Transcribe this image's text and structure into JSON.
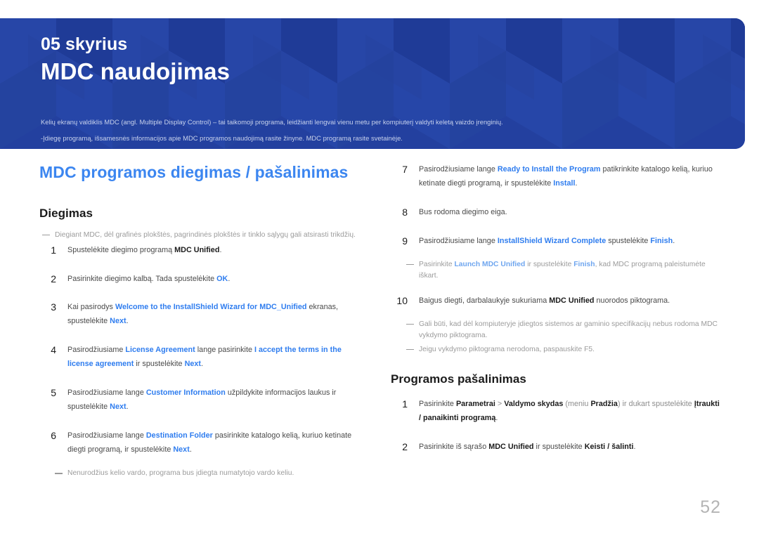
{
  "banner": {
    "chapter_label": "05 skyrius",
    "chapter_title": "MDC naudojimas",
    "description_line1": "Kelių ekranų valdiklis MDC (angl. Multiple Display Control) – tai taikomoji programa, leidžianti lengvai vienu metu per kompiuterį valdyti keletą vaizdo įrenginių.",
    "description_line2": "-Įdiegę programą, išsamesnės informacijos apie MDC programos naudojimą rasite žinyne. MDC programą rasite svetainėje.",
    "bg_color": "#23409f",
    "text_color": "#ffffff"
  },
  "section": {
    "title": "MDC programos diegimas / pašalinimas",
    "title_color": "#3c86f0"
  },
  "install": {
    "heading": "Diegimas",
    "intro_note": "Diegiant MDC, dėl grafinės plokštės, pagrindinės plokštės ir tinklo sąlygų gali atsirasti trikdžių.",
    "steps": [
      {
        "num": "1",
        "parts": [
          {
            "t": "Spustelėkite diegimo programą ",
            "s": "plain"
          },
          {
            "t": "MDC Unified",
            "s": "bold"
          },
          {
            "t": ".",
            "s": "plain"
          }
        ]
      },
      {
        "num": "2",
        "parts": [
          {
            "t": "Pasirinkite diegimo kalbą. Tada spustelėkite ",
            "s": "plain"
          },
          {
            "t": "OK",
            "s": "link"
          },
          {
            "t": ".",
            "s": "plain"
          }
        ]
      },
      {
        "num": "3",
        "parts": [
          {
            "t": "Kai pasirodys ",
            "s": "plain"
          },
          {
            "t": "Welcome to the InstallShield Wizard for MDC_Unified",
            "s": "link"
          },
          {
            "t": " ekranas, spustelėkite ",
            "s": "plain"
          },
          {
            "t": "Next",
            "s": "link"
          },
          {
            "t": ".",
            "s": "plain"
          }
        ]
      },
      {
        "num": "4",
        "parts": [
          {
            "t": "Pasirodžiusiame ",
            "s": "plain"
          },
          {
            "t": "License Agreement",
            "s": "link"
          },
          {
            "t": " lange pasirinkite ",
            "s": "plain"
          },
          {
            "t": "I accept the terms in the license agreement",
            "s": "link"
          },
          {
            "t": " ir spustelėkite ",
            "s": "plain"
          },
          {
            "t": "Next",
            "s": "link"
          },
          {
            "t": ".",
            "s": "plain"
          }
        ]
      },
      {
        "num": "5",
        "parts": [
          {
            "t": "Pasirodžiusiame lange ",
            "s": "plain"
          },
          {
            "t": "Customer Information",
            "s": "link"
          },
          {
            "t": " užpildykite informacijos laukus ir spustelėkite ",
            "s": "plain"
          },
          {
            "t": "Next",
            "s": "link"
          },
          {
            "t": ".",
            "s": "plain"
          }
        ]
      },
      {
        "num": "6",
        "parts": [
          {
            "t": "Pasirodžiusiame lange ",
            "s": "plain"
          },
          {
            "t": "Destination Folder",
            "s": "link"
          },
          {
            "t": " pasirinkite katalogo kelią, kuriuo ketinate diegti programą, ir spustelėkite ",
            "s": "plain"
          },
          {
            "t": "Next",
            "s": "link"
          },
          {
            "t": ".",
            "s": "plain"
          }
        ]
      }
    ],
    "step6_note": "Nenurodžius kelio vardo, programa bus įdiegta numatytojo vardo keliu.",
    "steps_right": [
      {
        "num": "7",
        "parts": [
          {
            "t": "Pasirodžiusiame lange ",
            "s": "plain"
          },
          {
            "t": "Ready to Install the Program",
            "s": "link"
          },
          {
            "t": " patikrinkite katalogo kelią, kuriuo ketinate diegti programą, ir spustelėkite ",
            "s": "plain"
          },
          {
            "t": "Install",
            "s": "link"
          },
          {
            "t": ".",
            "s": "plain"
          }
        ]
      },
      {
        "num": "8",
        "parts": [
          {
            "t": "Bus rodoma diegimo eiga.",
            "s": "plain"
          }
        ]
      },
      {
        "num": "9",
        "parts": [
          {
            "t": "Pasirodžiusiame lange ",
            "s": "plain"
          },
          {
            "t": "InstallShield Wizard Complete",
            "s": "link"
          },
          {
            "t": " spustelėkite ",
            "s": "plain"
          },
          {
            "t": "Finish",
            "s": "link"
          },
          {
            "t": ".",
            "s": "plain"
          }
        ]
      }
    ],
    "step9_note_parts": [
      {
        "t": "Pasirinkite ",
        "s": "plain"
      },
      {
        "t": "Launch MDC Unified",
        "s": "link"
      },
      {
        "t": " ir spustelėkite ",
        "s": "plain"
      },
      {
        "t": "Finish",
        "s": "link"
      },
      {
        "t": ", kad MDC programą paleistumėte iškart.",
        "s": "plain"
      }
    ],
    "step10": {
      "num": "10",
      "parts": [
        {
          "t": "Baigus diegti, darbalaukyje sukuriama ",
          "s": "plain"
        },
        {
          "t": "MDC Unified",
          "s": "bold"
        },
        {
          "t": " nuorodos piktograma.",
          "s": "plain"
        }
      ]
    },
    "step10_note1": "Gali būti, kad dėl kompiuteryje įdiegtos sistemos ar gaminio specifikacijų nebus rodoma MDC vykdymo piktograma.",
    "step10_note2": "Jeigu vykdymo piktograma nerodoma, paspauskite F5."
  },
  "uninstall": {
    "heading": "Programos pašalinimas",
    "steps": [
      {
        "num": "1",
        "parts": [
          {
            "t": "Pasirinkite ",
            "s": "plain"
          },
          {
            "t": "Parametrai",
            "s": "bold"
          },
          {
            "t": " > ",
            "s": "dim"
          },
          {
            "t": "Valdymo skydas",
            "s": "bold"
          },
          {
            "t": " (meniu ",
            "s": "dim"
          },
          {
            "t": "Pradžia",
            "s": "bold"
          },
          {
            "t": ") ir dukart spustelėkite ",
            "s": "dim"
          },
          {
            "t": "Įtraukti / panaikinti programą",
            "s": "bold"
          },
          {
            "t": ".",
            "s": "plain"
          }
        ]
      },
      {
        "num": "2",
        "parts": [
          {
            "t": "Pasirinkite iš sąrašo ",
            "s": "plain"
          },
          {
            "t": "MDC Unified",
            "s": "bold"
          },
          {
            "t": " ir spustelėkite ",
            "s": "plain"
          },
          {
            "t": "Keisti / šalinti",
            "s": "bold"
          },
          {
            "t": ".",
            "s": "plain"
          }
        ]
      }
    ]
  },
  "footer": {
    "page_number": "52"
  }
}
